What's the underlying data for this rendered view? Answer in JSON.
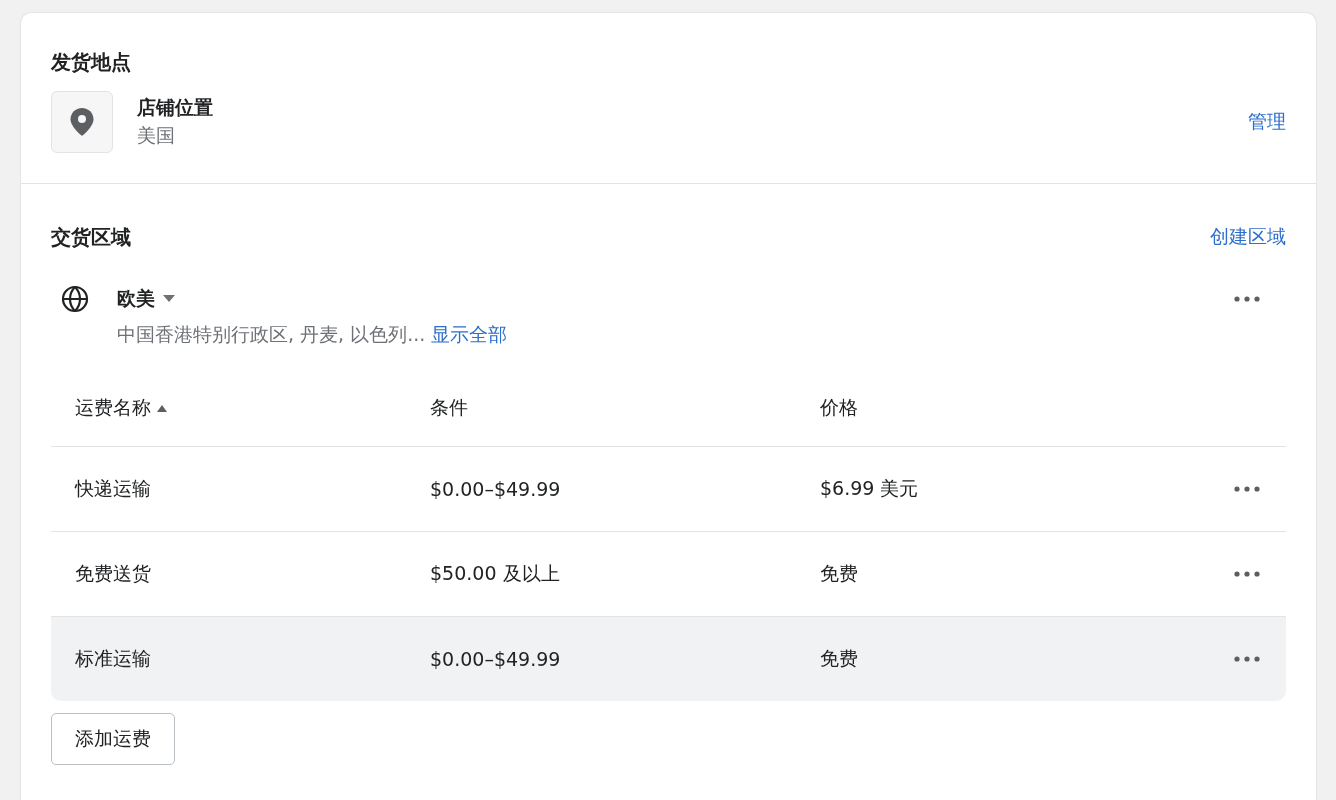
{
  "origin": {
    "title": "发货地点",
    "location_name": "店铺位置",
    "location_country": "美国",
    "manage_link": "管理"
  },
  "zones": {
    "title": "交货区域",
    "create_link": "创建区域",
    "zone_name": "欧美",
    "zone_regions": "中国香港特别行政区, 丹麦, 以色列...",
    "show_all_link": "显示全部",
    "table": {
      "columns": [
        "运费名称",
        "条件",
        "价格"
      ],
      "rows": [
        {
          "name": "快递运输",
          "condition": "$0.00–$49.99",
          "price": "$6.99 美元",
          "selected": false
        },
        {
          "name": "免费送货",
          "condition": "$50.00 及以上",
          "price": "免费",
          "selected": false
        },
        {
          "name": "标准运输",
          "condition": "$0.00–$49.99",
          "price": "免费",
          "selected": true
        }
      ]
    },
    "add_button": "添加运费"
  }
}
